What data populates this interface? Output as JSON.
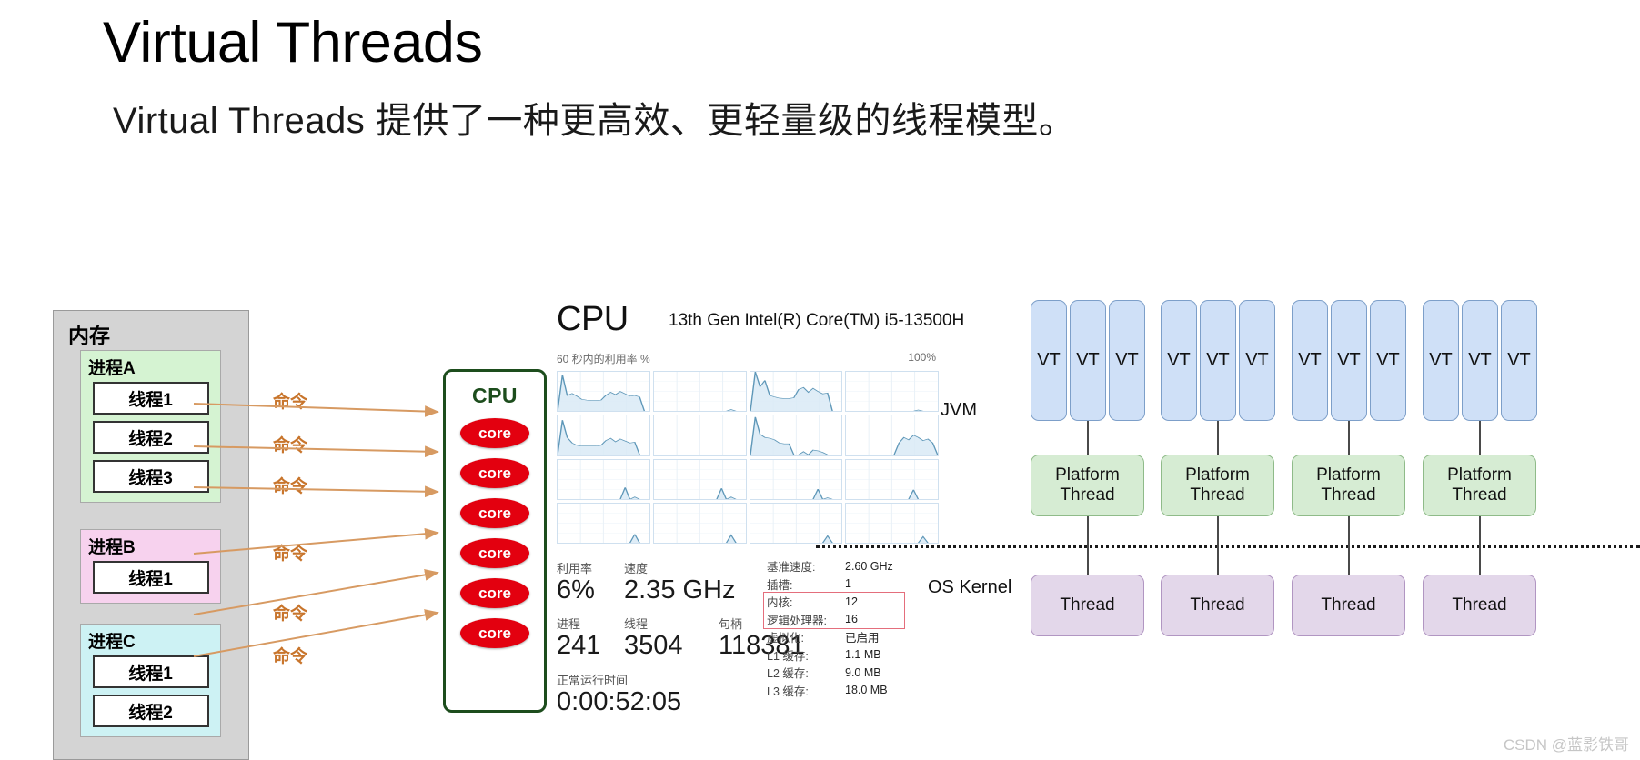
{
  "heading": {
    "title": "Virtual Threads",
    "subtitle": "Virtual Threads 提供了一种更高效、更轻量级的线程模型。"
  },
  "memory_diagram": {
    "box_label": "内存",
    "command_label": "命令",
    "processes": [
      {
        "name": "进程A",
        "color": "#d5f3d2",
        "threads": [
          "线程1",
          "线程2",
          "线程3"
        ]
      },
      {
        "name": "进程B",
        "color": "#f7d2ee",
        "threads": [
          "线程1"
        ]
      },
      {
        "name": "进程C",
        "color": "#cdf2f4",
        "threads": [
          "线程1",
          "线程2"
        ]
      }
    ],
    "cpu": {
      "title": "CPU",
      "core_label": "core",
      "core_count": 6,
      "border_color": "#1d4d1d",
      "core_color": "#e3000f"
    }
  },
  "task_manager": {
    "title": "CPU",
    "model": "13th Gen Intel(R) Core(TM) i5-13500H",
    "graph_caption": "60 秒内的利用率 %",
    "graph_max": "100%",
    "graph_cells": 16,
    "stats": [
      {
        "label": "利用率",
        "value": "6%"
      },
      {
        "label": "速度",
        "value": "2.35 GHz"
      },
      {
        "label": "进程",
        "value": "241"
      },
      {
        "label": "线程",
        "value": "3504"
      },
      {
        "label": "句柄",
        "value": "118381"
      },
      {
        "label": "正常运行时间",
        "value": "0:00:52:05"
      }
    ],
    "specs": [
      {
        "key": "基准速度:",
        "value": "2.60 GHz"
      },
      {
        "key": "插槽:",
        "value": "1"
      },
      {
        "key": "内核:",
        "value": "12"
      },
      {
        "key": "逻辑处理器:",
        "value": "16"
      },
      {
        "key": "虚拟化:",
        "value": "已启用"
      },
      {
        "key": "L1 缓存:",
        "value": "1.1 MB"
      },
      {
        "key": "L2 缓存:",
        "value": "9.0 MB"
      },
      {
        "key": "L3 缓存:",
        "value": "18.0 MB"
      }
    ],
    "highlight_color": "#e46e7c"
  },
  "vt_diagram": {
    "jvm_label": "JVM",
    "os_label": "OS Kernel",
    "vt_label": "VT",
    "platform_thread_label": "Platform\nThread",
    "platform_thread_line1": "Platform",
    "platform_thread_line2": "Thread",
    "thread_label": "Thread",
    "group_count": 4,
    "vt_per_group": 3,
    "vt_color": "#cfe0f7",
    "platform_color": "#d6ecd3",
    "thread_color": "#e3d7ea"
  },
  "watermark": "CSDN @蓝影铁哥"
}
